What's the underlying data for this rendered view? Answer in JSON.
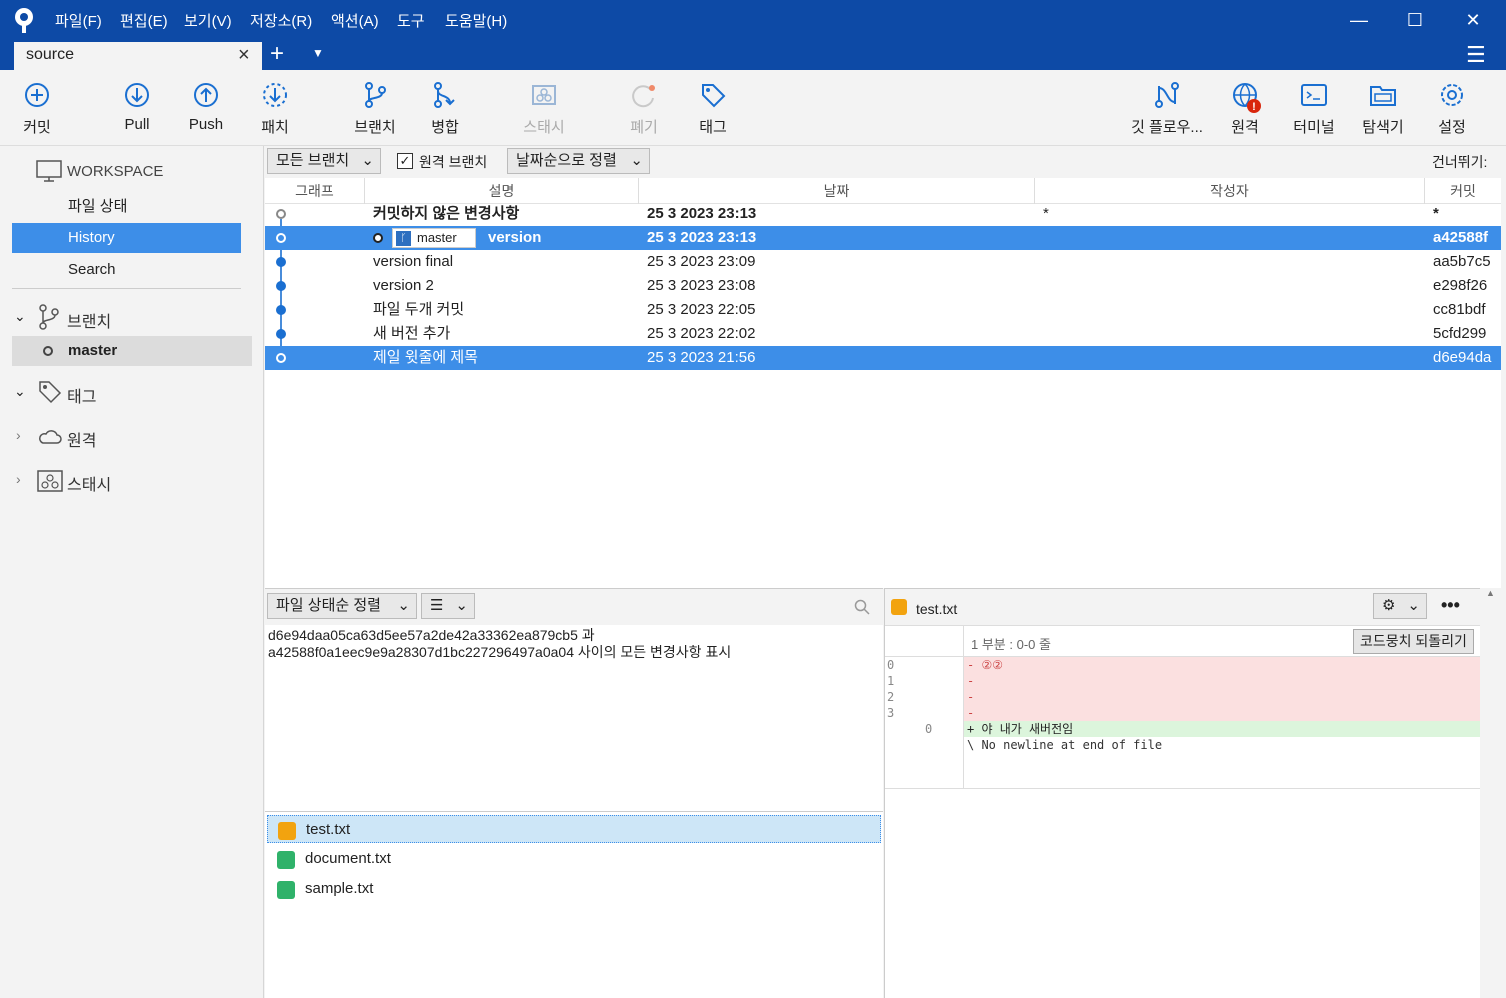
{
  "menu": [
    "파일(F)",
    "편집(E)",
    "보기(V)",
    "저장소(R)",
    "액션(A)",
    "도구",
    "도움말(H)"
  ],
  "tab": {
    "label": "source"
  },
  "toolbar": {
    "commit": "커밋",
    "pull": "Pull",
    "push": "Push",
    "patch": "패치",
    "branch": "브랜치",
    "merge": "병합",
    "stash": "스태시",
    "discard": "폐기",
    "tag": "태그",
    "gitflow": "깃 플로우...",
    "remote": "원격",
    "terminal": "터미널",
    "explorer": "탐색기",
    "settings": "설정"
  },
  "sidebar": {
    "workspace": "WORKSPACE",
    "file_status": "파일 상태",
    "history": "History",
    "search": "Search",
    "branches": "브랜치",
    "branch_master": "master",
    "tags": "태그",
    "remotes": "원격",
    "stashes": "스태시"
  },
  "filters": {
    "all_branches": "모든 브랜치",
    "remote_branches": "원격 브랜치",
    "sort": "날짜순으로 정렬",
    "skip": "건너뛰기:"
  },
  "columns": {
    "graph": "그래프",
    "desc": "설명",
    "date": "날짜",
    "author": "작성자",
    "commit": "커밋"
  },
  "commits": [
    {
      "desc": "커밋하지 않은 변경사항",
      "date": "25 3 2023 23:13",
      "author": "*",
      "hash": "*"
    },
    {
      "desc": "version",
      "date": "25 3 2023 23:13",
      "author": "",
      "hash": "a42588f",
      "branch": "master"
    },
    {
      "desc": "version final",
      "date": "25 3 2023 23:09",
      "author": "",
      "hash": "aa5b7c5"
    },
    {
      "desc": "version 2",
      "date": "25 3 2023 23:08",
      "author": "",
      "hash": "e298f26"
    },
    {
      "desc": "파일 두개 커밋",
      "date": "25 3 2023 22:05",
      "author": "",
      "hash": "cc81bdf"
    },
    {
      "desc": "새 버전 추가",
      "date": "25 3 2023 22:02",
      "author": "",
      "hash": "5cfd299"
    },
    {
      "desc": "제일 윗줄에 제목",
      "date": "25 3 2023 21:56",
      "author": "",
      "hash": "d6e94da"
    }
  ],
  "lower": {
    "sort_files": "파일 상태순 정렬",
    "summary_line1": "d6e94daa05ca63d5ee57a2de42a33362ea879cb5 과",
    "summary_line2": "a42588f0a1eec9e9a28307d1bc227296497a0a04 사이의 모든 변경사항 표시",
    "files": [
      "test.txt",
      "document.txt",
      "sample.txt"
    ]
  },
  "diff": {
    "file": "test.txt",
    "hunk": "1 부분 : 0-0 줄",
    "revert": "코드뭉치 되돌리기",
    "removed": [
      {
        "n": "0",
        "t": "- ②②"
      },
      {
        "n": "1",
        "t": "- "
      },
      {
        "n": "2",
        "t": "- "
      },
      {
        "n": "3",
        "t": "- "
      }
    ],
    "added": {
      "n": "0",
      "t": "+ 야 내가 새버전임"
    },
    "note": "\\ No newline at end of file"
  },
  "colors": {
    "accent": "#0d4aa6",
    "selection": "#3d8ee8"
  }
}
